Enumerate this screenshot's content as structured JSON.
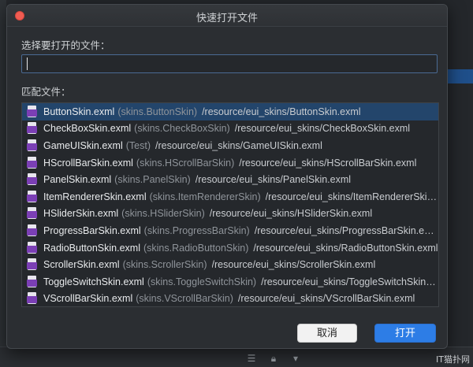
{
  "dialog": {
    "title": "快速打开文件",
    "select_label": "选择要打开的文件：",
    "search_value": "",
    "match_label": "匹配文件：",
    "cancel_label": "取消",
    "open_label": "打开"
  },
  "files": [
    {
      "name": "ButtonSkin.exml",
      "ns": "(skins.ButtonSkin)",
      "path": "/resource/eui_skins/ButtonSkin.exml",
      "selected": true
    },
    {
      "name": "CheckBoxSkin.exml",
      "ns": "(skins.CheckBoxSkin)",
      "path": "/resource/eui_skins/CheckBoxSkin.exml"
    },
    {
      "name": "GameUISkin.exml",
      "ns": "(Test)",
      "path": "/resource/eui_skins/GameUISkin.exml"
    },
    {
      "name": "HScrollBarSkin.exml",
      "ns": "(skins.HScrollBarSkin)",
      "path": "/resource/eui_skins/HScrollBarSkin.exml"
    },
    {
      "name": "PanelSkin.exml",
      "ns": "(skins.PanelSkin)",
      "path": "/resource/eui_skins/PanelSkin.exml"
    },
    {
      "name": "ItemRendererSkin.exml",
      "ns": "(skins.ItemRendererSkin)",
      "path": "/resource/eui_skins/ItemRendererSkin.e..."
    },
    {
      "name": "HSliderSkin.exml",
      "ns": "(skins.HSliderSkin)",
      "path": "/resource/eui_skins/HSliderSkin.exml"
    },
    {
      "name": "ProgressBarSkin.exml",
      "ns": "(skins.ProgressBarSkin)",
      "path": "/resource/eui_skins/ProgressBarSkin.exml"
    },
    {
      "name": "RadioButtonSkin.exml",
      "ns": "(skins.RadioButtonSkin)",
      "path": "/resource/eui_skins/RadioButtonSkin.exml"
    },
    {
      "name": "ScrollerSkin.exml",
      "ns": "(skins.ScrollerSkin)",
      "path": "/resource/eui_skins/ScrollerSkin.exml"
    },
    {
      "name": "ToggleSwitchSkin.exml",
      "ns": "(skins.ToggleSwitchSkin)",
      "path": "/resource/eui_skins/ToggleSwitchSkin.e..."
    },
    {
      "name": "VScrollBarSkin.exml",
      "ns": "(skins.VScrollBarSkin)",
      "path": "/resource/eui_skins/VScrollBarSkin.exml"
    }
  ],
  "icons": {
    "file": "exml-file-icon",
    "close": "close-icon"
  },
  "colors": {
    "selection": "#23456b",
    "primary_button": "#2d7de6",
    "close_button": "#f05c52",
    "file_badge": "#7b3fb5"
  },
  "watermark": "IT猫扑网"
}
